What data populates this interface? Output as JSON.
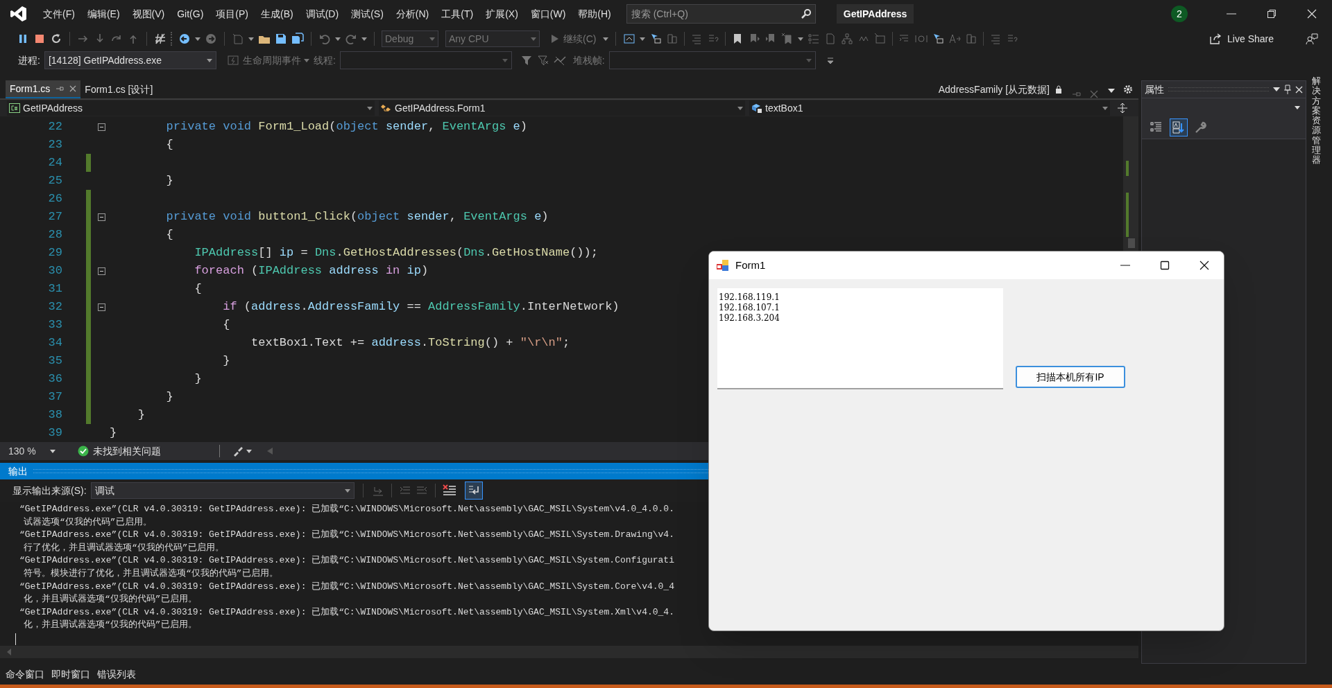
{
  "menu": [
    "文件(F)",
    "编辑(E)",
    "视图(V)",
    "Git(G)",
    "项目(P)",
    "生成(B)",
    "调试(D)",
    "测试(S)",
    "分析(N)",
    "工具(T)",
    "扩展(X)",
    "窗口(W)",
    "帮助(H)"
  ],
  "search": {
    "placeholder": "搜索 (Ctrl+Q)"
  },
  "window": {
    "title": "GetIPAddress",
    "notification_count": "2"
  },
  "toolbar": {
    "configuration": "Debug",
    "platform": "Any CPU",
    "continue": "继续(C)",
    "live_share": "Live Share"
  },
  "debug_location": {
    "process_label": "进程:",
    "process": "[14128] GetIPAddress.exe",
    "lifecycle": "生命周期事件",
    "thread_label": "线程:",
    "stack_label": "堆栈帧:"
  },
  "tabs": [
    {
      "label": "Form1.cs",
      "selected": true
    },
    {
      "label": "Form1.cs [设计]",
      "selected": false
    }
  ],
  "preview_tab": {
    "label": "AddressFamily [从元数据]"
  },
  "navigation": {
    "project": "GetIPAddress",
    "type": "GetIPAddress.Form1",
    "member": "textBox1"
  },
  "editor": {
    "lines": [
      {
        "number": "22",
        "changed": false,
        "foldable": true,
        "tokens": [
          {
            "text": "        private",
            "kind": "keyword"
          },
          {
            "text": " void",
            "kind": "keyword"
          },
          {
            "text": " Form1_Load",
            "kind": "method"
          },
          {
            "text": "(",
            "kind": "plain"
          },
          {
            "text": "object",
            "kind": "keyword"
          },
          {
            "text": " sender",
            "kind": "variable"
          },
          {
            "text": ", ",
            "kind": "plain"
          },
          {
            "text": "EventArgs",
            "kind": "type"
          },
          {
            "text": " e",
            "kind": "variable"
          },
          {
            "text": ")",
            "kind": "plain"
          }
        ]
      },
      {
        "number": "23",
        "changed": false,
        "foldable": false,
        "tokens": [
          {
            "text": "        {",
            "kind": "plain"
          }
        ]
      },
      {
        "number": "24",
        "changed": true,
        "foldable": false
      },
      {
        "number": "25",
        "changed": false,
        "foldable": false,
        "tokens": [
          {
            "text": "        }",
            "kind": "plain"
          }
        ]
      },
      {
        "number": "26",
        "changed": true,
        "foldable": false
      },
      {
        "number": "27",
        "changed": true,
        "foldable": true,
        "tokens": [
          {
            "text": "        private",
            "kind": "keyword"
          },
          {
            "text": " void",
            "kind": "keyword"
          },
          {
            "text": " button1_Click",
            "kind": "method"
          },
          {
            "text": "(",
            "kind": "plain"
          },
          {
            "text": "object",
            "kind": "keyword"
          },
          {
            "text": " sender",
            "kind": "variable"
          },
          {
            "text": ", ",
            "kind": "plain"
          },
          {
            "text": "EventArgs",
            "kind": "type"
          },
          {
            "text": " e",
            "kind": "variable"
          },
          {
            "text": ")",
            "kind": "plain"
          }
        ]
      },
      {
        "number": "28",
        "changed": true,
        "foldable": false,
        "tokens": [
          {
            "text": "        {",
            "kind": "plain"
          }
        ]
      },
      {
        "number": "29",
        "changed": true,
        "foldable": false,
        "tokens": [
          {
            "text": "            IPAddress",
            "kind": "type"
          },
          {
            "text": "[] ",
            "kind": "plain"
          },
          {
            "text": "ip",
            "kind": "variable"
          },
          {
            "text": " = ",
            "kind": "plain"
          },
          {
            "text": "Dns",
            "kind": "type"
          },
          {
            "text": ".",
            "kind": "plain"
          },
          {
            "text": "GetHostAddresses",
            "kind": "method"
          },
          {
            "text": "(",
            "kind": "plain"
          },
          {
            "text": "Dns",
            "kind": "type"
          },
          {
            "text": ".",
            "kind": "plain"
          },
          {
            "text": "GetHostName",
            "kind": "method"
          },
          {
            "text": "());",
            "kind": "plain"
          }
        ]
      },
      {
        "number": "30",
        "changed": true,
        "foldable": true,
        "tokens": [
          {
            "text": "            foreach",
            "kind": "control"
          },
          {
            "text": " (",
            "kind": "plain"
          },
          {
            "text": "IPAddress",
            "kind": "type"
          },
          {
            "text": " address",
            "kind": "variable"
          },
          {
            "text": " in",
            "kind": "control"
          },
          {
            "text": " ip",
            "kind": "variable"
          },
          {
            "text": ")",
            "kind": "plain"
          }
        ]
      },
      {
        "number": "31",
        "changed": true,
        "foldable": false,
        "tokens": [
          {
            "text": "            {",
            "kind": "plain"
          }
        ]
      },
      {
        "number": "32",
        "changed": true,
        "foldable": true,
        "tokens": [
          {
            "text": "                if",
            "kind": "control"
          },
          {
            "text": " (",
            "kind": "plain"
          },
          {
            "text": "address",
            "kind": "variable"
          },
          {
            "text": ".",
            "kind": "plain"
          },
          {
            "text": "AddressFamily",
            "kind": "variable"
          },
          {
            "text": " == ",
            "kind": "plain"
          },
          {
            "text": "AddressFamily",
            "kind": "type"
          },
          {
            "text": ".InterNetwork)",
            "kind": "plain"
          }
        ]
      },
      {
        "number": "33",
        "changed": true,
        "foldable": false,
        "tokens": [
          {
            "text": "                {",
            "kind": "plain"
          }
        ]
      },
      {
        "number": "34",
        "changed": true,
        "foldable": false,
        "tokens": [
          {
            "text": "                    textBox1.Text += ",
            "kind": "plain"
          },
          {
            "text": "address",
            "kind": "variable"
          },
          {
            "text": ".",
            "kind": "plain"
          },
          {
            "text": "ToString",
            "kind": "method"
          },
          {
            "text": "() + ",
            "kind": "plain"
          },
          {
            "text": "\"\\r\\n\"",
            "kind": "string"
          },
          {
            "text": ";",
            "kind": "plain"
          }
        ]
      },
      {
        "number": "35",
        "changed": true,
        "foldable": false,
        "tokens": [
          {
            "text": "                }",
            "kind": "plain"
          }
        ]
      },
      {
        "number": "36",
        "changed": true,
        "foldable": false,
        "tokens": [
          {
            "text": "            }",
            "kind": "plain"
          }
        ]
      },
      {
        "number": "37",
        "changed": true,
        "foldable": false,
        "tokens": [
          {
            "text": "        }",
            "kind": "plain"
          }
        ]
      },
      {
        "number": "38",
        "changed": true,
        "foldable": false,
        "tokens": [
          {
            "text": "    }",
            "kind": "plain"
          }
        ]
      },
      {
        "number": "39",
        "changed": false,
        "foldable": false,
        "tokens": [
          {
            "text": "}",
            "kind": "plain"
          }
        ]
      }
    ],
    "zoom": "130 %",
    "issues": "未找到相关问题"
  },
  "output": {
    "title": "输出",
    "source_label": "显示输出来源(S):",
    "source": "调试",
    "word_wrap": true,
    "messages": [
      {
        "line1": "“GetIPAddress.exe”(CLR v4.0.30319: GetIPAddress.exe): 已加载“C:\\WINDOWS\\Microsoft.Net\\assembly\\GAC_MSIL\\System\\v4.0_4.0.0.",
        "line2": "试器选项“仅我的代码”已启用。"
      },
      {
        "line1": "“GetIPAddress.exe”(CLR v4.0.30319: GetIPAddress.exe): 已加载“C:\\WINDOWS\\Microsoft.Net\\assembly\\GAC_MSIL\\System.Drawing\\v4.",
        "line2": "行了优化，并且调试器选项“仅我的代码”已启用。"
      },
      {
        "line1": "“GetIPAddress.exe”(CLR v4.0.30319: GetIPAddress.exe): 已加载“C:\\WINDOWS\\Microsoft.Net\\assembly\\GAC_MSIL\\System.Configurati",
        "line2": "符号。模块进行了优化，并且调试器选项“仅我的代码”已启用。"
      },
      {
        "line1": "“GetIPAddress.exe”(CLR v4.0.30319: GetIPAddress.exe): 已加载“C:\\WINDOWS\\Microsoft.Net\\assembly\\GAC_MSIL\\System.Core\\v4.0_4",
        "line2": "化，并且调试器选项“仅我的代码”已启用。"
      },
      {
        "line1": "“GetIPAddress.exe”(CLR v4.0.30319: GetIPAddress.exe): 已加载“C:\\WINDOWS\\Microsoft.Net\\assembly\\GAC_MSIL\\System.Xml\\v4.0_4.",
        "line2": "化，并且调试器选项“仅我的代码”已启用。"
      }
    ]
  },
  "bottom_tabs": [
    "命令窗口",
    "即时窗口",
    "错误列表"
  ],
  "properties": {
    "title": "属性",
    "view_buttons": [
      {
        "selected": false
      },
      {
        "selected": true
      },
      {
        "selected": false
      }
    ]
  },
  "side_tab": "解决方案资源管理器",
  "form": {
    "title": "Form1",
    "textbox_lines": [
      "192.168.119.1",
      "192.168.107.1",
      "192.168.3.204"
    ],
    "button": "扫描本机所有IP"
  }
}
